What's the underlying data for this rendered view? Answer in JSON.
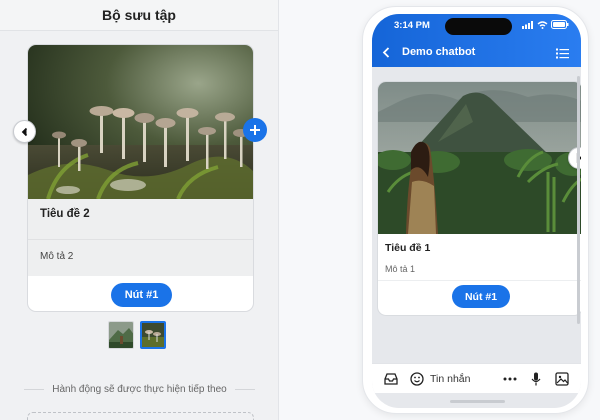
{
  "editor": {
    "title": "Bộ sưu tập",
    "card": {
      "title": "Tiêu đề 2",
      "description": "Mô tả 2",
      "button_label": "Nút #1"
    },
    "next_action_text": "Hành động sẽ được thực hiện tiếp theo"
  },
  "phone": {
    "status": {
      "time": "3:14 PM"
    },
    "chat_name": "Demo chatbot",
    "card": {
      "title": "Tiêu đề 1",
      "description": "Mô tả 1",
      "button_label": "Nút #1"
    },
    "input_placeholder": "Tin nhắn"
  },
  "colors": {
    "accent": "#1a73e8",
    "header_gradient_start": "#1565d8",
    "header_gradient_end": "#2a7df0"
  }
}
